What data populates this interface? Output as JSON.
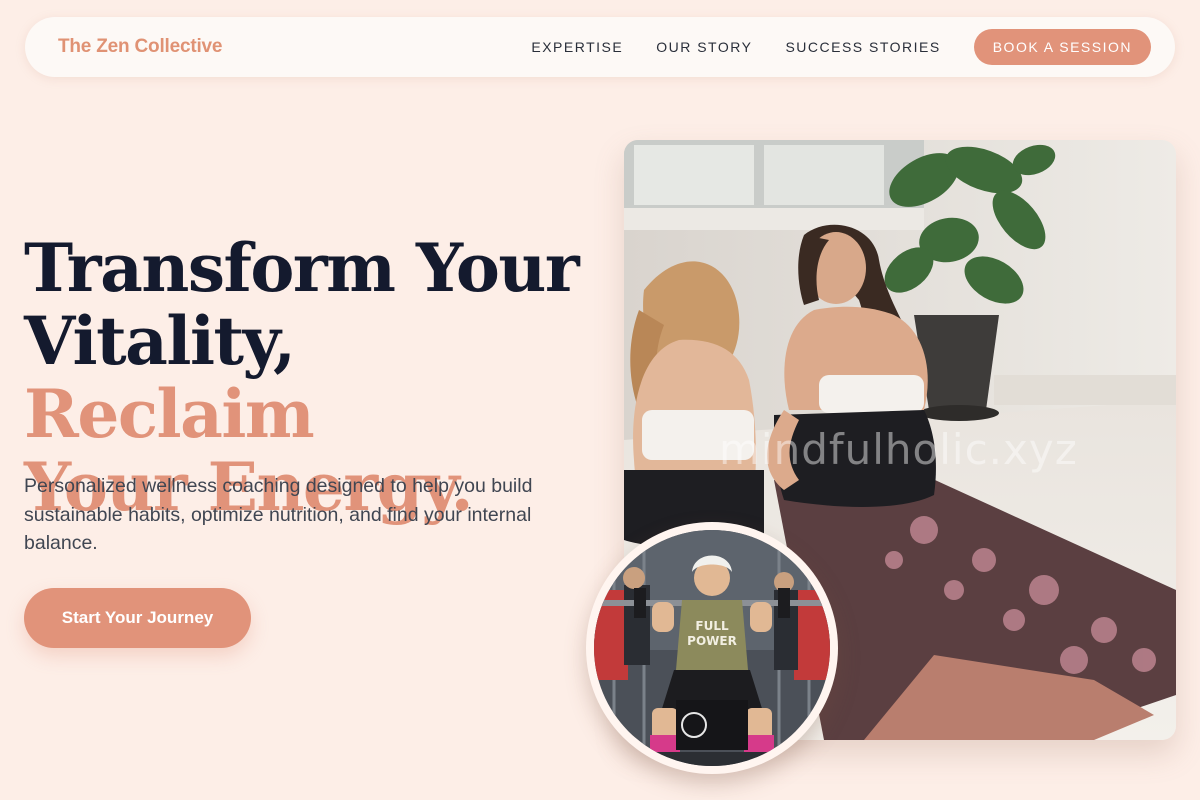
{
  "nav": {
    "brand": "The Zen Collective",
    "links": [
      "EXPERTISE",
      "OUR STORY",
      "SUCCESS STORIES"
    ],
    "cta": "BOOK A SESSION"
  },
  "hero": {
    "title_line1": "Transform Your",
    "title_line2_dark": "Vitality,",
    "title_line2_accent": "Reclaim",
    "title_line3_accent": "Your Energy.",
    "subtitle": "Personalized wellness coaching designed to help you build sustainable habits, optimize nutrition, and find your internal balance.",
    "cta": "Start Your Journey"
  },
  "images": {
    "main_photo": "two-women-yoga-mat-photo",
    "main_watermark": "mindfulholic.xyz",
    "circle_photo": "woman-barbell-squat-photo"
  },
  "colors": {
    "background": "#fdeee7",
    "accent": "#e1937a",
    "heading": "#141a2e"
  }
}
